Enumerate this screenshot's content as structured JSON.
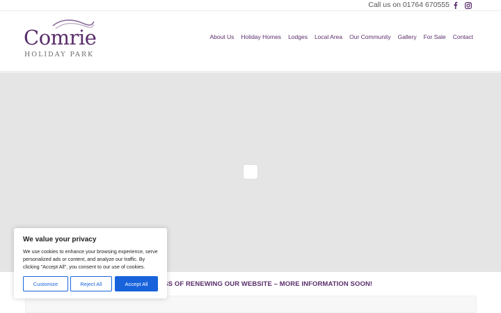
{
  "topbar": {
    "phone": "Call us on 01764 670555",
    "social": [
      {
        "icon": "facebook-icon"
      },
      {
        "icon": "instagram-icon"
      }
    ]
  },
  "logo": {
    "brand": "Comrie",
    "sub": "HOLIDAY PARK"
  },
  "nav": {
    "items": [
      {
        "label": "About Us"
      },
      {
        "label": "Holiday Homes"
      },
      {
        "label": "Lodges"
      },
      {
        "label": "Local Area"
      },
      {
        "label": "Our Community"
      },
      {
        "label": "Gallery"
      },
      {
        "label": "For Sale"
      },
      {
        "label": "Contact"
      }
    ]
  },
  "notice": {
    "text": "HE PROCESS OF RENEWING OUR WEBSITE – MORE INFORMATION SOON!"
  },
  "cookie": {
    "title": "We value your privacy",
    "description": "We use cookies to enhance your browsing experience, serve personalized ads or content, and analyze our traffic. By clicking \"Accept All\", you consent to our use of cookies.",
    "customize_label": "Customize",
    "reject_label": "Reject All",
    "accept_label": "Accept All"
  },
  "colors": {
    "brand_purple": "#5a2e6b",
    "accent_blue": "#1863dc",
    "map_grey": "#e5e5e5"
  }
}
